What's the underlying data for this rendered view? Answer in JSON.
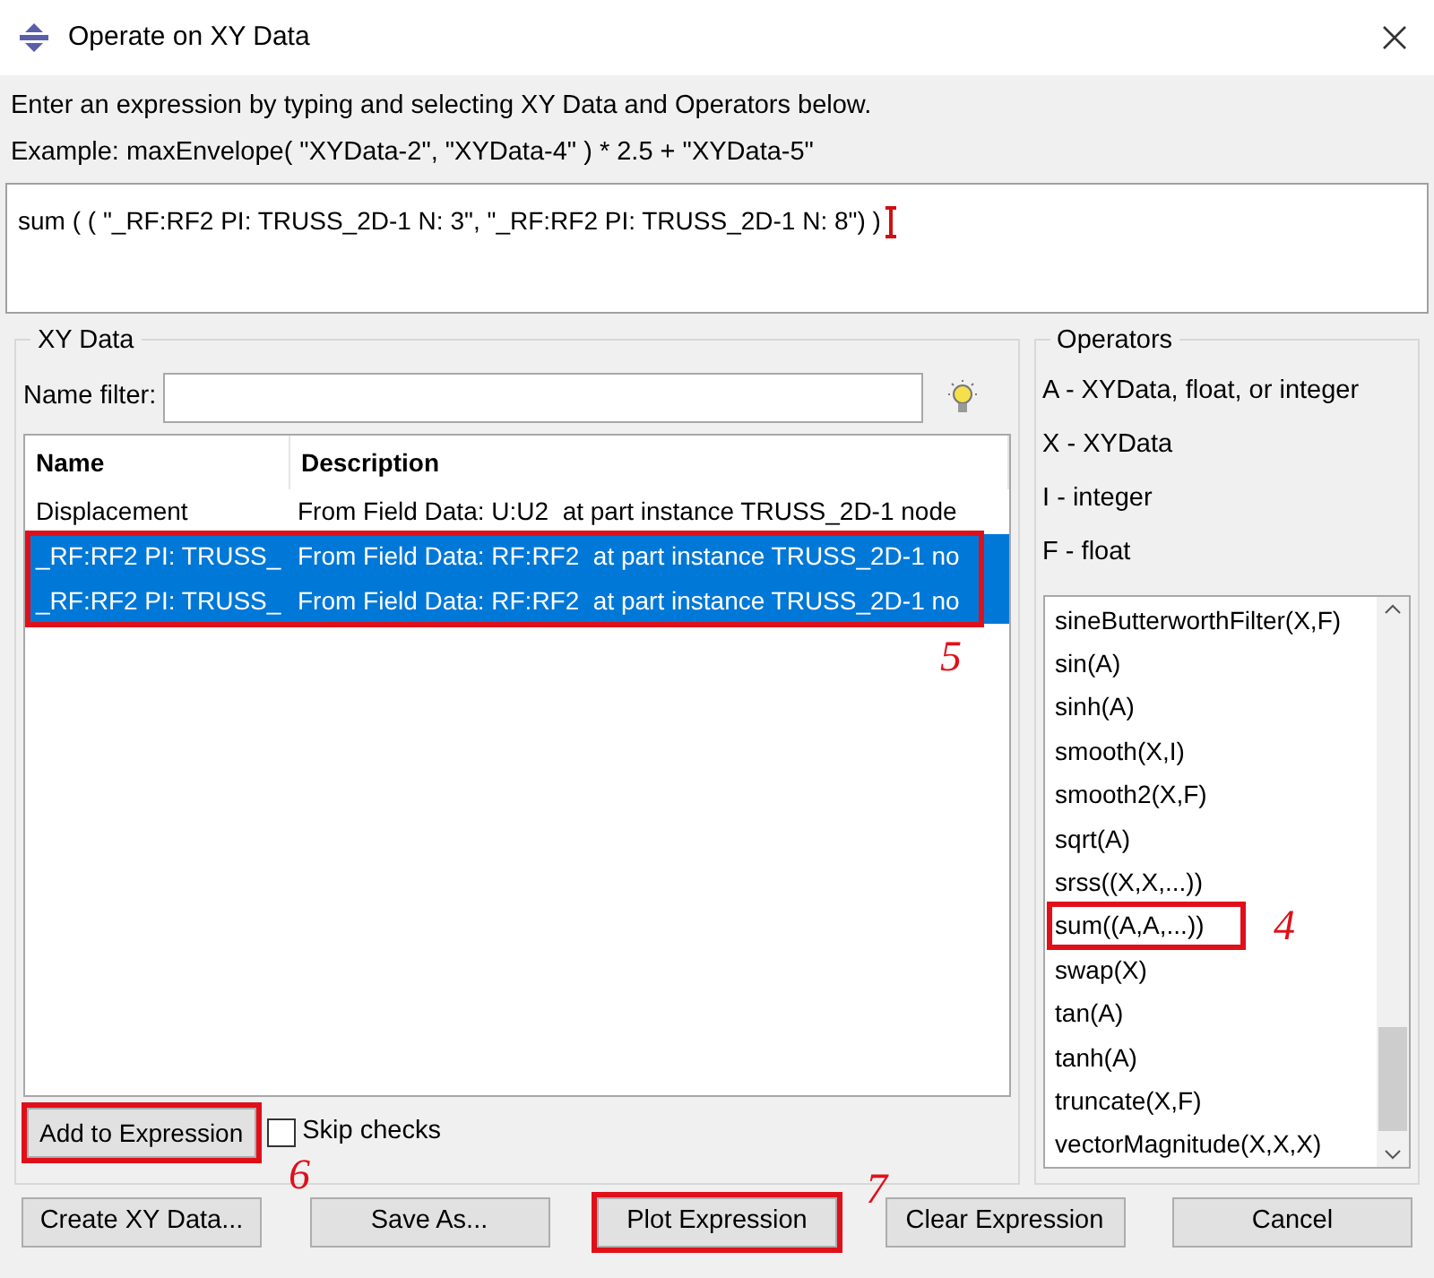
{
  "window": {
    "title": "Operate on XY Data"
  },
  "instructions": [
    "Enter an expression by typing and selecting XY Data and Operators below.",
    "Example: maxEnvelope( \"XYData-2\", \"XYData-4\" ) * 2.5 + \"XYData-5\""
  ],
  "expression": {
    "value": "sum ( ( \"_RF:RF2 PI: TRUSS_2D-1 N: 3\", \"_RF:RF2 PI: TRUSS_2D-1 N: 8\") )"
  },
  "xy_data": {
    "title": "XY Data",
    "name_filter": {
      "label": "Name filter:"
    },
    "table": {
      "columns": [
        "Name",
        "Description"
      ],
      "callout": "5",
      "rows": [
        {
          "name": "Displacement",
          "description": "From Field Data: U:U2  at part instance TRUSS_2D-1 node",
          "selected": false
        },
        {
          "name": "_RF:RF2 PI: TRUSS_",
          "description": "From Field Data: RF:RF2  at part instance TRUSS_2D-1 no",
          "selected": true
        },
        {
          "name": "_RF:RF2 PI: TRUSS_",
          "description": "From Field Data: RF:RF2  at part instance TRUSS_2D-1 no",
          "selected": true
        }
      ]
    },
    "add_button": {
      "label": "Add to Expression",
      "callout": "6"
    },
    "skip_checks": {
      "label": "Skip checks",
      "checked": false
    }
  },
  "operators": {
    "title": "Operators",
    "legend": [
      "A - XYData, float, or integer",
      "X - XYData",
      "I - integer",
      "F - float"
    ],
    "items": [
      {
        "label": "sineButterworthFilter(X,F)"
      },
      {
        "label": "sin(A)"
      },
      {
        "label": "sinh(A)"
      },
      {
        "label": "smooth(X,I)"
      },
      {
        "label": "smooth2(X,F)"
      },
      {
        "label": "sqrt(A)"
      },
      {
        "label": "srss((X,X,...))"
      },
      {
        "label": "sum((A,A,...))",
        "callout": "4"
      },
      {
        "label": "swap(X)"
      },
      {
        "label": "tan(A)"
      },
      {
        "label": "tanh(A)"
      },
      {
        "label": "truncate(X,F)"
      },
      {
        "label": "vectorMagnitude(X,X,X)"
      }
    ]
  },
  "buttons": [
    {
      "label": "Create XY Data..."
    },
    {
      "label": "Save As..."
    },
    {
      "label": "Plot Expression",
      "callout": "7"
    },
    {
      "label": "Clear Expression"
    },
    {
      "label": "Cancel"
    }
  ]
}
